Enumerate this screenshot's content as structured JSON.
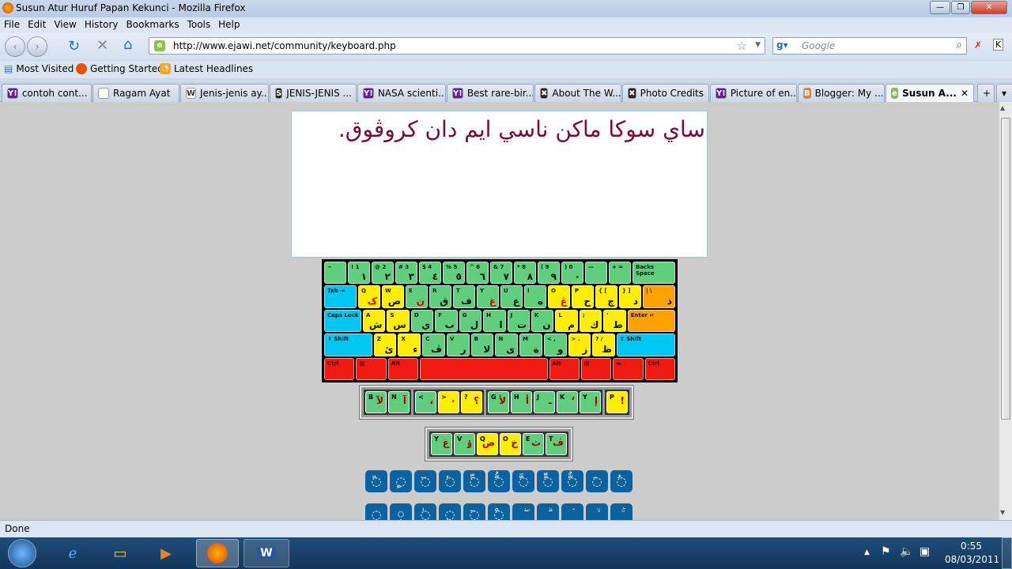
{
  "window": {
    "title": "Susun Atur Huruf Papan Kekunci - Mozilla Firefox"
  },
  "menu": [
    "File",
    "Edit",
    "View",
    "History",
    "Bookmarks",
    "Tools",
    "Help"
  ],
  "nav": {
    "url": "http://www.ejawi.net/community/keyboard.php",
    "search_placeholder": "Google"
  },
  "bookmarks": [
    "Most Visited",
    "Getting Started",
    "Latest Headlines"
  ],
  "tabs": [
    {
      "label": "contoh cont...",
      "icon": "Y!",
      "color": "#6a1b9a"
    },
    {
      "label": "Ragam Ayat",
      "icon": "",
      "color": "#ffffff"
    },
    {
      "label": "Jenis-jenis ay...",
      "icon": "W",
      "color": "#ffffff"
    },
    {
      "label": "JENIS-JENIS ...",
      "icon": "S",
      "color": "#222222"
    },
    {
      "label": "NASA scienti...",
      "icon": "Y!",
      "color": "#6a1b9a"
    },
    {
      "label": "Best rare-bir...",
      "icon": "Y!",
      "color": "#6a1b9a"
    },
    {
      "label": "About The W...",
      "icon": "✖",
      "color": "#222222"
    },
    {
      "label": "Photo Credits",
      "icon": "✖",
      "color": "#222222"
    },
    {
      "label": "Picture of en...",
      "icon": "Y!",
      "color": "#6a1b9a"
    },
    {
      "label": "Blogger: My ...",
      "icon": "B",
      "color": "#f57c00"
    },
    {
      "label": "Susun A...",
      "icon": "e",
      "color": "#8bc34a",
      "active": true
    }
  ],
  "editor": {
    "text": "ساي سوكا ماکن ناسي ايم دان کروڤوق."
  },
  "colors": {
    "green": "#5fcf7e",
    "yellow": "#ffee00",
    "blue": "#00c6f2",
    "orange": "#ffa200",
    "red": "#f01a10"
  },
  "keyboard": [
    [
      {
        "t": "~",
        "a": "",
        "c": "green"
      },
      {
        "t": "! 1",
        "a": "١",
        "c": "green"
      },
      {
        "t": "@ 2",
        "a": "٢",
        "c": "green"
      },
      {
        "t": "# 3",
        "a": "٣",
        "c": "green"
      },
      {
        "t": "$ 4",
        "a": "٤",
        "c": "green"
      },
      {
        "t": "% 5",
        "a": "٥",
        "c": "green"
      },
      {
        "t": "^ 6",
        "a": "٦",
        "c": "green"
      },
      {
        "t": "& 7",
        "a": "٧",
        "c": "green"
      },
      {
        "t": "* 8",
        "a": "٨",
        "c": "green"
      },
      {
        "t": "( 9",
        "a": "٩",
        "c": "green"
      },
      {
        "t": ") 0",
        "a": "٠",
        "c": "green"
      },
      {
        "t": "—",
        "a": "",
        "c": "green"
      },
      {
        "t": "+ =",
        "a": "",
        "c": "green"
      },
      {
        "t": "Backs Space",
        "a": "",
        "c": "green",
        "w": 2
      }
    ],
    [
      {
        "t": "Tab ⇥",
        "a": "",
        "c": "blue",
        "w": 1.5
      },
      {
        "t": "Q",
        "a": "ک",
        "c": "yellow",
        "r": 1
      },
      {
        "t": "W",
        "a": "ص",
        "c": "yellow"
      },
      {
        "t": "E",
        "a": "ن",
        "c": "green",
        "r": 1
      },
      {
        "t": "R",
        "a": "ق",
        "c": "green"
      },
      {
        "t": "T",
        "a": "ف",
        "c": "green"
      },
      {
        "t": "Y",
        "a": "غ",
        "c": "green",
        "r": 1
      },
      {
        "t": "U",
        "a": "ع",
        "c": "green"
      },
      {
        "t": "I",
        "a": "ه",
        "c": "green"
      },
      {
        "t": "O",
        "a": "ڠ",
        "c": "yellow",
        "r": 1
      },
      {
        "t": "P",
        "a": "ح",
        "c": "yellow"
      },
      {
        "t": "{ [",
        "a": "چ",
        "c": "yellow"
      },
      {
        "t": "} ]",
        "a": "د",
        "c": "yellow"
      },
      {
        "t": "| \\",
        "a": "ذ",
        "c": "orange",
        "w": 1.5
      }
    ],
    [
      {
        "t": "Caps Lock",
        "a": "",
        "c": "blue",
        "w": 1.7
      },
      {
        "t": "A",
        "a": "ش",
        "c": "yellow"
      },
      {
        "t": "S",
        "a": "س",
        "c": "yellow"
      },
      {
        "t": "D",
        "a": "ي",
        "c": "green"
      },
      {
        "t": "F",
        "a": "ب",
        "c": "green"
      },
      {
        "t": "G",
        "a": "ل",
        "c": "green"
      },
      {
        "t": "H",
        "a": "ا",
        "c": "green"
      },
      {
        "t": "J",
        "a": "ت",
        "c": "green"
      },
      {
        "t": "K",
        "a": "ن",
        "c": "green"
      },
      {
        "t": "L",
        "a": "م",
        "c": "yellow"
      },
      {
        "t": ";",
        "a": "ك",
        "c": "yellow"
      },
      {
        "t": "'",
        "a": "ط",
        "c": "yellow"
      },
      {
        "t": "Enter ↵",
        "a": "",
        "c": "orange",
        "w": 2.2
      }
    ],
    [
      {
        "t": "⇧ Shift",
        "a": "",
        "c": "blue",
        "w": 2.2
      },
      {
        "t": "Z",
        "a": "ئ",
        "c": "yellow"
      },
      {
        "t": "X",
        "a": "ء",
        "c": "yellow"
      },
      {
        "t": "C",
        "a": "ڤ",
        "c": "green"
      },
      {
        "t": "V",
        "a": "ر",
        "c": "green"
      },
      {
        "t": "B",
        "a": "لا",
        "c": "green"
      },
      {
        "t": "N",
        "a": "ى",
        "c": "green"
      },
      {
        "t": "M",
        "a": "ة",
        "c": "green"
      },
      {
        "t": "< ,",
        "a": "و",
        "c": "green"
      },
      {
        "t": "> .",
        "a": "ز",
        "c": "yellow"
      },
      {
        "t": "? /",
        "a": "ظ",
        "c": "yellow"
      },
      {
        "t": "⇧ Shift",
        "a": "",
        "c": "blue",
        "w": 2.7
      }
    ],
    [
      {
        "t": "Ctrl",
        "a": "",
        "c": "red",
        "w": 1.3
      },
      {
        "t": "▤",
        "a": "",
        "c": "red",
        "w": 1.3
      },
      {
        "t": "Alt",
        "a": "",
        "c": "red",
        "w": 1.3
      },
      {
        "t": "",
        "a": "",
        "c": "red",
        "w": 5.7
      },
      {
        "t": "Alt",
        "a": "",
        "c": "red",
        "w": 1.3
      },
      {
        "t": "▤",
        "a": "",
        "c": "red",
        "w": 1.3
      },
      {
        "t": "▬",
        "a": "",
        "c": "red",
        "w": 1.3
      },
      {
        "t": "Ctrl",
        "a": "",
        "c": "red",
        "w": 1.3
      }
    ]
  ],
  "shift_strip": [
    [
      {
        "t": "B",
        "a": "لآ",
        "c": "green"
      },
      {
        "t": "N",
        "a": "آ",
        "c": "green"
      }
    ],
    [
      {
        "t": "<",
        "a": "،",
        "c": "green"
      },
      {
        "t": ">",
        "a": "٠",
        "c": "yellow"
      },
      {
        "t": "?",
        "a": "؟",
        "c": "yellow"
      }
    ],
    [
      {
        "t": "G",
        "a": "لأ",
        "c": "green"
      },
      {
        "t": "H",
        "a": "أ",
        "c": "green"
      },
      {
        "t": "J",
        "a": "ـ",
        "c": "green"
      },
      {
        "t": "K",
        "a": "‘",
        "c": "green"
      },
      {
        "t": "Y",
        "a": "إ",
        "c": "green"
      }
    ],
    [
      {
        "t": "P",
        "a": "!",
        "c": "yellow"
      }
    ]
  ],
  "extra_strip": [
    {
      "t": "Y",
      "a": "غ",
      "c": "green"
    },
    {
      "t": "V",
      "a": "ۏ",
      "c": "green"
    },
    {
      "t": "Q",
      "a": "ض",
      "c": "yellow"
    },
    {
      "t": "O",
      "a": "خ",
      "c": "yellow"
    },
    {
      "t": "E",
      "a": "ث",
      "c": "green"
    },
    {
      "t": "T",
      "a": "ڤ",
      "c": "green"
    }
  ],
  "diacritics_row1": [
    "◌ً",
    "◌ٍ",
    "◌ٓ",
    "◌ٔ",
    "◌ِّ",
    "◌ُّ",
    "◌َّ",
    "◌ٍّ",
    "◌ٌّ",
    "◌َ",
    "◌ُ"
  ],
  "diacritics_row2": [
    "◌",
    "◌ٖ",
    "◌ٰ",
    "◌ٕ",
    "◌ٓ",
    "◌ْ",
    "ۖ",
    "ۗ",
    "ۘ",
    "ۙ",
    "ۚ"
  ],
  "status": {
    "text": "Done"
  },
  "clock": {
    "time": "0:55",
    "date": "08/03/2011"
  }
}
